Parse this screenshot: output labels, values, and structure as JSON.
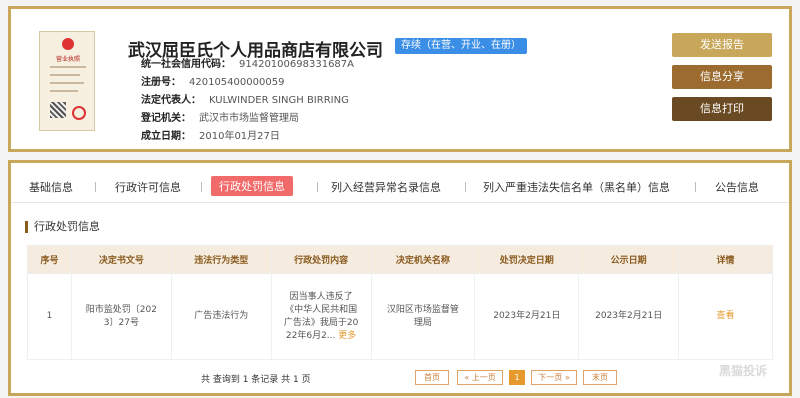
{
  "company": {
    "name": "武汉屈臣氏个人用品商店有限公司",
    "status": "存续（在营、开业、在册）",
    "fields": [
      {
        "label": "统一社会信用代码：",
        "value": "91420100698331687A"
      },
      {
        "label": "注册号：",
        "value": "420105400000059"
      },
      {
        "label": "法定代表人：",
        "value": "KULWINDER SINGH BIRRING"
      },
      {
        "label": "登记机关：",
        "value": "武汉市市场监督管理局"
      },
      {
        "label": "成立日期：",
        "value": "2010年01月27日"
      }
    ],
    "license_image": {
      "title": "营业执照"
    }
  },
  "actions": [
    {
      "label": "发送报告",
      "color": "#c9a75a"
    },
    {
      "label": "信息分享",
      "color": "#9b6b2f"
    },
    {
      "label": "信息打印",
      "color": "#6a4a22"
    }
  ],
  "tabs": [
    {
      "label": "基础信息"
    },
    {
      "label": "行政许可信息"
    },
    {
      "label": "行政处罚信息",
      "active": true
    },
    {
      "label": "列入经营异常名录信息"
    },
    {
      "label": "列入严重违法失信名单（黑名单）信息"
    },
    {
      "label": "公告信息"
    }
  ],
  "section": {
    "title": "行政处罚信息"
  },
  "table": {
    "headers": [
      "序号",
      "决定书文号",
      "违法行为类型",
      "行政处罚内容",
      "决定机关名称",
      "处罚决定日期",
      "公示日期",
      "详情"
    ],
    "rows": [
      {
        "index": "1",
        "doc_no_1": "阳市监处罚〔202",
        "doc_no_2": "3〕27号",
        "type": "广告违法行为",
        "content_1": "因当事人违反了",
        "content_2": "《中华人民共和国",
        "content_3": "广告法》我局于20",
        "content_4": "22年6月2...",
        "more": "更多",
        "authority_1": "汉阳区市场监督管",
        "authority_2": "理局",
        "decision_date": "2023年2月21日",
        "publish_date": "2023年2月21日",
        "detail": "查看"
      }
    ]
  },
  "pagination": {
    "summary": "共 查询到 1 条记录 共 1 页",
    "first": "首页",
    "prev": "« 上一页",
    "current": "1",
    "next": "下一页 »",
    "last": "末页"
  },
  "watermark": "黑猫投诉"
}
